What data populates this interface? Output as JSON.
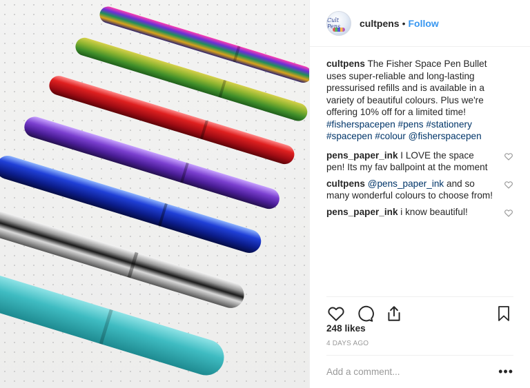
{
  "post": {
    "username": "cultpens",
    "avatar_text": "Cult Pens",
    "separator": "•",
    "follow_label": "Follow",
    "caption": {
      "user": "cultpens",
      "text": "The Fisher Space Pen Bullet uses super-reliable and long-lasting pressurised refills and is available in a variety of beautiful colours. Plus we're offering 10% off for a limited time!",
      "hashtags": [
        "#fisherspacepen",
        "#pens",
        "#stationery",
        "#spacepen",
        "#colour"
      ],
      "mention": "@fisherspacepen"
    },
    "comments": [
      {
        "user": "pens_paper_ink",
        "text": "I LOVE the space pen! Its my fav ballpoint at the moment",
        "mention": ""
      },
      {
        "user": "cultpens",
        "text": "and so many wonderful colours to choose from!",
        "mention": "@pens_paper_ink"
      },
      {
        "user": "pens_paper_ink",
        "text": "i know beautiful!",
        "mention": ""
      }
    ],
    "likes": "248 likes",
    "time": "4 DAYS AGO",
    "comment_placeholder": "Add a comment...",
    "more_label": "•••"
  },
  "icons": {
    "like": "heart-icon",
    "comment": "comment-icon",
    "share": "share-icon",
    "save": "bookmark-icon",
    "comment_like": "heart-icon"
  },
  "colors": {
    "link": "#3897f0",
    "hashtag": "#003569",
    "muted": "#999999",
    "text": "#262626",
    "pens": [
      "rainbow",
      "green-gold",
      "red",
      "purple",
      "blue",
      "chrome",
      "turquoise"
    ]
  }
}
